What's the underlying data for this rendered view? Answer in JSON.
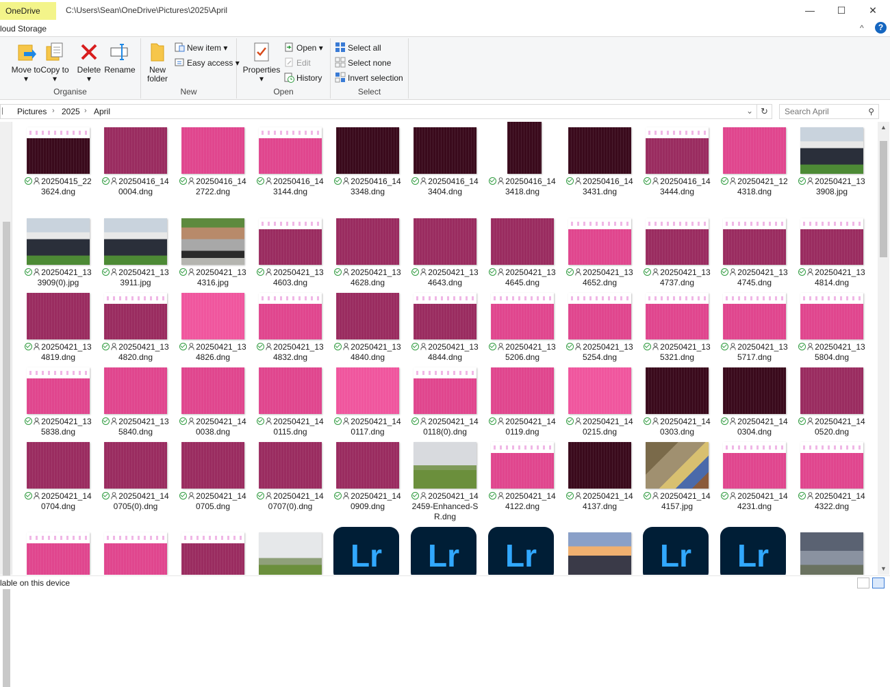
{
  "window": {
    "onedrive_tab": "OneDrive",
    "path": "C:\\Users\\Sean\\OneDrive\\Pictures\\2025\\April",
    "minimize": "—",
    "maximize": "☐",
    "close": "✕"
  },
  "ribbon_tabs": {
    "cloud_tab": "loud Storage",
    "minimize_ribbon": "^",
    "help": "?"
  },
  "ribbon": {
    "organise": {
      "label": "Organise",
      "move_to": "Move to",
      "copy_to": "Copy to",
      "delete": "Delete",
      "rename": "Rename"
    },
    "new": {
      "label": "New",
      "new_folder": "New folder",
      "new_item": "New item",
      "easy_access": "Easy access"
    },
    "open": {
      "label": "Open",
      "properties": "Properties",
      "open": "Open",
      "edit": "Edit",
      "history": "History"
    },
    "select": {
      "label": "Select",
      "select_all": "Select all",
      "select_none": "Select none",
      "invert_selection": "Invert selection"
    }
  },
  "address": {
    "crumbs": [
      "Pictures",
      "2025",
      "April"
    ],
    "search_placeholder": "Search April"
  },
  "files": [
    {
      "name": "20250415_223624.dng",
      "thumb": "dark",
      "band": true
    },
    {
      "name": "20250416_140004.dng",
      "thumb": "mid",
      "band": false
    },
    {
      "name": "20250416_142722.dng",
      "thumb": "bright",
      "band": false
    },
    {
      "name": "20250416_143144.dng",
      "thumb": "bright",
      "band": true
    },
    {
      "name": "20250416_143348.dng",
      "thumb": "dark",
      "band": false
    },
    {
      "name": "20250416_143404.dng",
      "thumb": "dark",
      "band": false
    },
    {
      "name": "20250416_143418.dng",
      "thumb": "portrait",
      "band": false
    },
    {
      "name": "20250416_143431.dng",
      "thumb": "dark",
      "band": false
    },
    {
      "name": "20250416_143444.dng",
      "thumb": "mid",
      "band": true
    },
    {
      "name": "20250421_124318.dng",
      "thumb": "bright",
      "band": false
    },
    {
      "name": "20250421_133908.jpg",
      "thumb": "photo-crowd",
      "band": false
    },
    {
      "name": "20250421_133909(0).jpg",
      "thumb": "photo-crowd",
      "band": false
    },
    {
      "name": "20250421_133911.jpg",
      "thumb": "photo-crowd",
      "band": false
    },
    {
      "name": "20250421_134316.jpg",
      "thumb": "photo-street",
      "band": false
    },
    {
      "name": "20250421_134603.dng",
      "thumb": "mid",
      "band": true
    },
    {
      "name": "20250421_134628.dng",
      "thumb": "mid",
      "band": false
    },
    {
      "name": "20250421_134643.dng",
      "thumb": "mid",
      "band": false
    },
    {
      "name": "20250421_134645.dng",
      "thumb": "mid",
      "band": false
    },
    {
      "name": "20250421_134652.dng",
      "thumb": "bright",
      "band": true
    },
    {
      "name": "20250421_134737.dng",
      "thumb": "mid",
      "band": true
    },
    {
      "name": "20250421_134745.dng",
      "thumb": "mid",
      "band": true
    },
    {
      "name": "20250421_134814.dng",
      "thumb": "mid",
      "band": true
    },
    {
      "name": "20250421_134819.dng",
      "thumb": "mid",
      "band": false
    },
    {
      "name": "20250421_134820.dng",
      "thumb": "mid",
      "band": true
    },
    {
      "name": "20250421_134826.dng",
      "thumb": "hot",
      "band": false
    },
    {
      "name": "20250421_134832.dng",
      "thumb": "bright",
      "band": true
    },
    {
      "name": "20250421_134840.dng",
      "thumb": "mid",
      "band": false
    },
    {
      "name": "20250421_134844.dng",
      "thumb": "mid",
      "band": true
    },
    {
      "name": "20250421_135206.dng",
      "thumb": "bright",
      "band": true
    },
    {
      "name": "20250421_135254.dng",
      "thumb": "bright",
      "band": true
    },
    {
      "name": "20250421_135321.dng",
      "thumb": "bright",
      "band": true
    },
    {
      "name": "20250421_135717.dng",
      "thumb": "bright",
      "band": true
    },
    {
      "name": "20250421_135804.dng",
      "thumb": "bright",
      "band": true
    },
    {
      "name": "20250421_135838.dng",
      "thumb": "bright",
      "band": true
    },
    {
      "name": "20250421_135840.dng",
      "thumb": "bright",
      "band": false
    },
    {
      "name": "20250421_140038.dng",
      "thumb": "bright",
      "band": false
    },
    {
      "name": "20250421_140115.dng",
      "thumb": "bright",
      "band": false
    },
    {
      "name": "20250421_140117.dng",
      "thumb": "hot",
      "band": false
    },
    {
      "name": "20250421_140118(0).dng",
      "thumb": "bright",
      "band": true
    },
    {
      "name": "20250421_140119.dng",
      "thumb": "bright",
      "band": false
    },
    {
      "name": "20250421_140215.dng",
      "thumb": "hot",
      "band": false
    },
    {
      "name": "20250421_140303.dng",
      "thumb": "dark",
      "band": false
    },
    {
      "name": "20250421_140304.dng",
      "thumb": "dark",
      "band": false
    },
    {
      "name": "20250421_140520.dng",
      "thumb": "mid",
      "band": false
    },
    {
      "name": "20250421_140704.dng",
      "thumb": "mid",
      "band": false
    },
    {
      "name": "20250421_140705(0).dng",
      "thumb": "mid",
      "band": false
    },
    {
      "name": "20250421_140705.dng",
      "thumb": "mid",
      "band": false
    },
    {
      "name": "20250421_140707(0).dng",
      "thumb": "mid",
      "band": false
    },
    {
      "name": "20250421_140909.dng",
      "thumb": "mid",
      "band": false
    },
    {
      "name": "20250421_142459-Enhanced-SR.dng",
      "thumb": "photo-field",
      "band": false
    },
    {
      "name": "20250421_144122.dng",
      "thumb": "bright",
      "band": true
    },
    {
      "name": "20250421_144137.dng",
      "thumb": "dark",
      "band": false
    },
    {
      "name": "20250421_144157.jpg",
      "thumb": "photo-junk",
      "band": false
    },
    {
      "name": "20250421_144231.dng",
      "thumb": "bright",
      "band": true
    },
    {
      "name": "20250421_144322.dng",
      "thumb": "bright",
      "band": true
    },
    {
      "name": "",
      "thumb": "bright",
      "band": true
    },
    {
      "name": "",
      "thumb": "bright",
      "band": true
    },
    {
      "name": "",
      "thumb": "mid",
      "band": true
    },
    {
      "name": "",
      "thumb": "photo-field2",
      "band": false
    },
    {
      "name": "",
      "thumb": "lr",
      "band": false
    },
    {
      "name": "",
      "thumb": "lr",
      "band": false
    },
    {
      "name": "",
      "thumb": "lr",
      "band": false
    },
    {
      "name": "",
      "thumb": "photo-sunset",
      "band": false
    },
    {
      "name": "",
      "thumb": "lr",
      "band": false
    },
    {
      "name": "",
      "thumb": "lr",
      "band": false
    },
    {
      "name": "",
      "thumb": "photo-sky",
      "band": false
    }
  ],
  "lr_label": "Lr",
  "statusbar": {
    "text": "lable on this device"
  },
  "colors": {
    "dark": "#3a0a1c",
    "mid": "#9a2c60",
    "bright": "#e0468e",
    "hot": "#f0569e",
    "accent": "#0078d7",
    "onedrive_tab": "#f3f48a"
  }
}
